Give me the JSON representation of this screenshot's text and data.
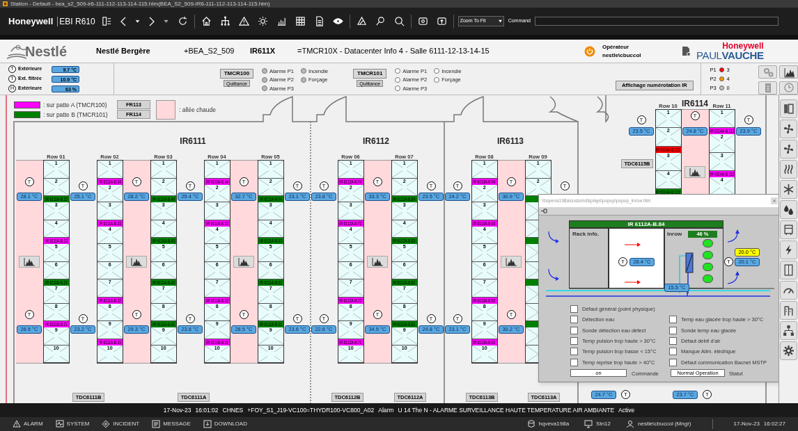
{
  "window": {
    "title": "Station - Default - bea_s2_509-ir6-111-112-113-114-115.htm(BEA_S2_509-IR6-111-112-113-114-115.htm)"
  },
  "toolbar": {
    "brand": "Honeywell",
    "product": "EBI R610",
    "zoom": "Zoom To Fit",
    "command_label": "Command"
  },
  "header": {
    "logo": "Nestlé",
    "site": "Nestlé Bergère",
    "location": "+BEA_S2_509",
    "unit": "IR611X",
    "description": "=TMCR10X - Datacenter Info 4 - Salle 6111-12-13-14-15",
    "operator_label": "Opérateur",
    "operator": "nestle\\cbuccol",
    "brand": "Honeywell",
    "brand_sub": "PAUL**VAUCHE**"
  },
  "outdoor": [
    {
      "sensor": "T",
      "label": "Extérieure",
      "value": "9.7 °C"
    },
    {
      "sensor": "T",
      "label": "Ext. filtrée",
      "value": "10.9 °C"
    },
    {
      "sensor": "H",
      "label": "Extérieure",
      "value": "63 %"
    }
  ],
  "controllers": [
    {
      "name": "TMCR100",
      "ack": "Quittance",
      "greyed": true,
      "alarms": [
        "Alarme P1",
        "Alarme P2",
        "Alarme P3"
      ],
      "others": [
        "Incendie",
        "Forçage"
      ]
    },
    {
      "name": "TMCR101",
      "ack": "Quittance",
      "greyed": false,
      "alarms": [
        "Alarme P1",
        "Alarme P2",
        "Alarme P3"
      ],
      "others": [
        "Incendie",
        "Forçage"
      ]
    }
  ],
  "numbering_button": "Affichage numérotation IR",
  "priorities": [
    {
      "label": "P1",
      "color": "#ff0000",
      "count": "3"
    },
    {
      "label": "P2",
      "color": "#ff9900",
      "count": "4"
    },
    {
      "label": "P3",
      "color": "#c0c0c0",
      "count": "0"
    }
  ],
  "legend": [
    {
      "color": "#ff00ff",
      "text": ": sur patte A (TMCR100)",
      "button": "FR113"
    },
    {
      "color": "#008000",
      "text": ": sur patte B (TMCR101)",
      "button": "FR114"
    }
  ],
  "hot_legend": ": allée chaude",
  "rooms": [
    {
      "title": "IR6111",
      "buttons": [
        "TDC6111B",
        "TDC6111A"
      ],
      "columns": [
        {
          "kind": "hot",
          "chart": true,
          "temps": [
            {
              "sensor": "T",
              "value": "28.1 °C"
            },
            {
              "sensor": "T",
              "value": "26.5 °C"
            }
          ]
        },
        {
          "kind": "rack",
          "label": "Row 01",
          "items": [
            {
              "kind": "slot",
              "label": "1"
            },
            {
              "kind": "slot",
              "label": "2"
            },
            {
              "kind": "tag",
              "text": "IR 6111A-B.22",
              "color": "#008000"
            },
            {
              "kind": "slot",
              "label": "3"
            },
            {
              "kind": "slot",
              "label": "4"
            },
            {
              "kind": "tag",
              "text": "IR 6111A-B.12",
              "color": "#ff00ff"
            },
            {
              "kind": "slot",
              "label": "5"
            },
            {
              "kind": "slot",
              "label": "6"
            },
            {
              "kind": "tag",
              "text": "IR 6111A-B.21",
              "color": "#008000"
            },
            {
              "kind": "slot",
              "label": "7"
            },
            {
              "kind": "slot",
              "label": "8"
            },
            {
              "kind": "tag",
              "text": "IR 6111A-B.11",
              "color": "#ff00ff"
            },
            {
              "kind": "slot",
              "label": "9"
            },
            {
              "kind": "slot",
              "label": "10"
            }
          ]
        },
        {
          "kind": "cold",
          "temps": [
            {
              "sensor": "T",
              "value": "25.1 °C"
            },
            {
              "sensor": "T",
              "value": "23.2 °C"
            }
          ]
        },
        {
          "kind": "rack",
          "label": "Row 02",
          "items": [
            {
              "kind": "slot",
              "label": "1"
            },
            {
              "kind": "tag",
              "text": "IR 6111A-B.34",
              "color": "#ff00ff"
            },
            {
              "kind": "slot",
              "label": "2"
            },
            {
              "kind": "slot",
              "label": "3"
            },
            {
              "kind": "tag",
              "text": "IR 6111A-B.33",
              "color": "#ff00ff"
            },
            {
              "kind": "slot",
              "label": "4"
            },
            {
              "kind": "slot",
              "label": "5"
            },
            {
              "kind": "slot",
              "label": "6"
            },
            {
              "kind": "slot",
              "label": "7"
            },
            {
              "kind": "tag",
              "text": "IR 6111A-B.32",
              "color": "#ff00ff"
            },
            {
              "kind": "slot",
              "label": "8"
            },
            {
              "kind": "slot",
              "label": "9"
            },
            {
              "kind": "tag",
              "text": "IR 6111A-B.31",
              "color": "#ff00ff"
            },
            {
              "kind": "slot",
              "label": "10"
            }
          ]
        },
        {
          "kind": "hot",
          "chart": true,
          "temps": [
            {
              "sensor": "T",
              "value": "28.2 °C"
            },
            {
              "sensor": "T",
              "value": "29.3 °C"
            }
          ]
        },
        {
          "kind": "rack",
          "label": "Row 03",
          "items": [
            {
              "kind": "slot",
              "label": "1"
            },
            {
              "kind": "slot",
              "label": "2"
            },
            {
              "kind": "tag",
              "text": "IR 6111A-B.44",
              "color": "#008000"
            },
            {
              "kind": "slot",
              "label": "3"
            },
            {
              "kind": "slot",
              "label": "4"
            },
            {
              "kind": "tag",
              "text": "IR 6111A-B.43",
              "color": "#008000"
            },
            {
              "kind": "slot",
              "label": "5"
            },
            {
              "kind": "slot",
              "label": "6"
            },
            {
              "kind": "tag",
              "text": "IR 6111A-B.42",
              "color": "#008000"
            },
            {
              "kind": "slot",
              "label": "7"
            },
            {
              "kind": "slot",
              "label": "8"
            },
            {
              "kind": "tag",
              "text": "IR 6111A-B.41",
              "color": "#008000"
            },
            {
              "kind": "slot",
              "label": "9"
            },
            {
              "kind": "slot",
              "label": "10"
            }
          ]
        },
        {
          "kind": "cold",
          "temps": [
            {
              "sensor": "T",
              "value": "25.4 °C"
            },
            {
              "sensor": "T",
              "value": "23.8 °C"
            }
          ]
        },
        {
          "kind": "rack",
          "label": "Row 04",
          "items": [
            {
              "kind": "slot",
              "label": "1"
            },
            {
              "kind": "tag",
              "text": "IR 6111A-B.34",
              "color": "#ff00ff"
            },
            {
              "kind": "slot",
              "label": "2"
            },
            {
              "kind": "slot",
              "label": "3"
            },
            {
              "kind": "tag",
              "text": "IR 6111A-B.33",
              "color": "#ff00ff"
            },
            {
              "kind": "slot",
              "label": "4"
            },
            {
              "kind": "slot",
              "label": "5"
            },
            {
              "kind": "slot",
              "label": "6"
            },
            {
              "kind": "slot",
              "label": "7"
            },
            {
              "kind": "tag",
              "text": "IR 6111A-B.32",
              "color": "#ff00ff"
            },
            {
              "kind": "slot",
              "label": "8"
            },
            {
              "kind": "slot",
              "label": "9"
            },
            {
              "kind": "tag",
              "text": "IR 6111A-B.31",
              "color": "#ff00ff"
            },
            {
              "kind": "slot",
              "label": "10"
            }
          ]
        },
        {
          "kind": "hot",
          "chart": true,
          "temps": [
            {
              "sensor": "T",
              "value": "32.7 °C"
            },
            {
              "sensor": "T",
              "value": "28.5 °C"
            }
          ]
        },
        {
          "kind": "rack",
          "label": "Row 05",
          "items": [
            {
              "kind": "slot",
              "label": "1"
            },
            {
              "kind": "slot",
              "label": "2"
            },
            {
              "kind": "tag",
              "text": "IR 6111A-B.04",
              "color": "#008000"
            },
            {
              "kind": "slot",
              "label": "3"
            },
            {
              "kind": "slot",
              "label": "4"
            },
            {
              "kind": "tag",
              "text": "IR 6111A-B.03",
              "color": "#008000"
            },
            {
              "kind": "slot",
              "label": "5"
            },
            {
              "kind": "slot",
              "label": "6"
            },
            {
              "kind": "tag",
              "text": "IR 6111A-B.02",
              "color": "#008000"
            },
            {
              "kind": "slot",
              "label": "7"
            },
            {
              "kind": "slot",
              "label": "8"
            },
            {
              "kind": "tag",
              "text": "IR 6111A-B.01",
              "color": "#008000"
            },
            {
              "kind": "slot",
              "label": "9"
            },
            {
              "kind": "slot",
              "label": "10"
            }
          ]
        },
        {
          "kind": "cold",
          "temps": [
            {
              "sensor": "T",
              "value": "23.1 °C"
            },
            {
              "sensor": "T",
              "value": "23.6 °C"
            }
          ]
        }
      ]
    },
    {
      "title": "IR6112",
      "buttons": [
        "TDC6112B",
        "TDC6112A"
      ],
      "columns": [
        {
          "kind": "cold",
          "temps": [
            {
              "sensor": "T",
              "value": "23.8 °C"
            },
            {
              "sensor": "T",
              "value": "22.6 °C"
            }
          ]
        },
        {
          "kind": "rack",
          "label": "Row 06",
          "items": [
            {
              "kind": "slot",
              "label": "1"
            },
            {
              "kind": "tag",
              "text": "IR 6112A-B.74",
              "color": "#ff00ff"
            },
            {
              "kind": "slot",
              "label": "2"
            },
            {
              "kind": "slot",
              "label": "3"
            },
            {
              "kind": "tag",
              "text": "IR 6112A-B.73",
              "color": "#ff00ff"
            },
            {
              "kind": "slot",
              "label": "4"
            },
            {
              "kind": "slot",
              "label": "5"
            },
            {
              "kind": "slot",
              "label": "6"
            },
            {
              "kind": "slot",
              "label": "7"
            },
            {
              "kind": "tag",
              "text": "IR 6112A-B.72",
              "color": "#ff00ff"
            },
            {
              "kind": "slot",
              "label": "8"
            },
            {
              "kind": "slot",
              "label": "9"
            },
            {
              "kind": "tag",
              "text": "IR 6112A-B.71",
              "color": "#ff00ff"
            },
            {
              "kind": "slot",
              "label": "10"
            }
          ]
        },
        {
          "kind": "hot",
          "chart": true,
          "temps": [
            {
              "sensor": "T",
              "value": "33.3 °C"
            },
            {
              "sensor": "T",
              "value": "34.5 °C"
            }
          ]
        },
        {
          "kind": "rack",
          "label": "Row 07",
          "items": [
            {
              "kind": "slot",
              "label": "1"
            },
            {
              "kind": "slot",
              "label": "2"
            },
            {
              "kind": "tag",
              "text": "IR 6112A-B.84",
              "color": "#008000"
            },
            {
              "kind": "slot",
              "label": "3"
            },
            {
              "kind": "slot",
              "label": "4"
            },
            {
              "kind": "tag",
              "text": "IR 6112A-B.83",
              "color": "#008000"
            },
            {
              "kind": "slot",
              "label": "5"
            },
            {
              "kind": "slot",
              "label": "6"
            },
            {
              "kind": "tag",
              "text": "IR 6112A-B.82",
              "color": "#008000"
            },
            {
              "kind": "slot",
              "label": "7"
            },
            {
              "kind": "slot",
              "label": "8"
            },
            {
              "kind": "tag",
              "text": "IR 6112A-B.81",
              "color": "#008000"
            },
            {
              "kind": "slot",
              "label": "9"
            },
            {
              "kind": "slot",
              "label": "10"
            }
          ]
        },
        {
          "kind": "cold",
          "temps": [
            {
              "sensor": "T",
              "value": "23.5 °C"
            },
            {
              "sensor": "T",
              "value": "24.8 °C"
            }
          ]
        }
      ]
    },
    {
      "title": "IR6113",
      "buttons": [
        "TDC6113B",
        "TDC6113A"
      ],
      "columns": [
        {
          "kind": "cold",
          "temps": [
            {
              "sensor": "T",
              "value": "24.2 °C"
            },
            {
              "sensor": "T",
              "value": "23.1 °C"
            }
          ]
        },
        {
          "kind": "rack",
          "label": "Row 08",
          "items": [
            {
              "kind": "slot",
              "label": "1"
            },
            {
              "kind": "tag",
              "text": "IR 6113A-B.94",
              "color": "#ff00ff"
            },
            {
              "kind": "slot",
              "label": "2"
            },
            {
              "kind": "slot",
              "label": "3"
            },
            {
              "kind": "tag",
              "text": "IR 6113A-B.93",
              "color": "#ff00ff"
            },
            {
              "kind": "slot",
              "label": "4"
            },
            {
              "kind": "slot",
              "label": "5"
            },
            {
              "kind": "slot",
              "label": "6"
            },
            {
              "kind": "slot",
              "label": "7"
            },
            {
              "kind": "tag",
              "text": "IR 6113A-B.92",
              "color": "#ff00ff"
            },
            {
              "kind": "slot",
              "label": "8"
            },
            {
              "kind": "slot",
              "label": "9"
            },
            {
              "kind": "tag",
              "text": "IR 6113A-B.91",
              "color": "#ff00ff"
            },
            {
              "kind": "slot",
              "label": "10"
            }
          ]
        },
        {
          "kind": "hot",
          "chart": true,
          "temps": [
            {
              "sensor": "T",
              "value": "30.9 °C"
            },
            {
              "sensor": "T",
              "value": "30.2 °C"
            }
          ]
        },
        {
          "kind": "rack",
          "label": "Row 09",
          "items": [
            {
              "kind": "slot",
              "label": "1"
            },
            {
              "kind": "slot",
              "label": "2"
            },
            {
              "kind": "tag",
              "color": "#008000"
            },
            {
              "kind": "slot"
            },
            {
              "kind": "slot"
            },
            {
              "kind": "tag",
              "color": "#008000"
            },
            {
              "kind": "slot"
            },
            {
              "kind": "slot"
            },
            {
              "kind": "tag",
              "color": "#008000"
            },
            {
              "kind": "slot"
            },
            {
              "kind": "slot"
            },
            {
              "kind": "tag",
              "color": "#008000"
            },
            {
              "kind": "slot"
            },
            {
              "kind": "slot"
            }
          ]
        },
        {
          "kind": "cold",
          "temps": [
            {
              "sensor": "T"
            }
          ]
        }
      ]
    },
    {
      "title": "IR6114",
      "buttons": [
        "TDC6115B"
      ],
      "bottom_temps": [
        {
          "sensor": "T",
          "value": "24.7 °C"
        },
        {
          "sensor": "T",
          "value": "23.7 °C"
        }
      ],
      "columns": [
        {
          "kind": "cold",
          "temps": [
            {
              "sensor": "T",
              "value": "23.5 °C"
            }
          ]
        },
        {
          "kind": "rack",
          "label": "Row 10",
          "items": [
            {
              "kind": "slot",
              "label": "1"
            },
            {
              "kind": "slot",
              "label": "2"
            },
            {
              "kind": "tag",
              "text": "IR 6114A-B.123",
              "color": "#ff0000"
            },
            {
              "kind": "slot",
              "label": "3"
            },
            {
              "kind": "slot",
              "label": "4"
            },
            {
              "kind": "tag",
              "text": "IR 6114A-B.122",
              "color": "#008000"
            }
          ]
        },
        {
          "kind": "hot",
          "chart": true,
          "temps": [
            {
              "sensor": "T",
              "value": "24.8 °C"
            }
          ]
        },
        {
          "kind": "rack",
          "label": "Row 11",
          "items": [
            {
              "kind": "slot",
              "label": "1"
            },
            {
              "kind": "tag",
              "text": "IR 6114A-B.113",
              "color": "#ff00ff"
            },
            {
              "kind": "slot",
              "label": "2"
            },
            {
              "kind": "slot",
              "label": "3"
            },
            {
              "kind": "tag",
              "text": "IR 6114A-B.112",
              "color": "#ff00ff"
            },
            {
              "kind": "slot",
              "label": "4"
            }
          ]
        },
        {
          "kind": "cold",
          "temps": [
            {
              "sensor": "T",
              "value": "23.9 °C"
            }
          ]
        }
      ]
    }
  ],
  "popup": {
    "path": "\\\\hqveva198a\\customdisplays\\popup\\popup_inrow.htm",
    "unit": "IR 6112A-B.84",
    "rack_info": "Rack info.",
    "inrow_label": "Inrow",
    "inrow_level": "46 %",
    "rack_temp": {
      "sensor": "T",
      "value": "28.4 °C"
    },
    "setpoint": "20.0 °C",
    "supply_temp": {
      "sensor": "T",
      "value": "20.1 °C"
    },
    "water_temp": "15.5 °C",
    "fans": [
      {
        "on": true
      },
      {
        "on": true
      },
      {
        "on": true
      },
      {
        "on": true
      }
    ],
    "faults_left": [
      {
        "label": "Défaut général (point physique)",
        "checked": false
      },
      {
        "label": "Détection eau",
        "checked": false
      },
      {
        "label": "Sonde détection eau défect",
        "checked": false
      },
      {
        "label": "Temp pulsion trop haute > 30°C",
        "checked": false
      },
      {
        "label": "Temp pulsion trop basse < 15°C",
        "checked": false
      },
      {
        "label": "Temp reprise trop haute > 40°C",
        "checked": false
      }
    ],
    "faults_right": [
      {
        "label": "Temp eau glacée trop haute > 30°C",
        "checked": false
      },
      {
        "label": "Sonde temp eau glacée",
        "checked": false
      },
      {
        "label": "Défaut debit d'air",
        "checked": false
      },
      {
        "label": "Manque Alim. élédrique",
        "checked": false
      },
      {
        "label": "Défaut communication Bacnet MSTP",
        "checked": false
      }
    ],
    "command": {
      "value": "on",
      "label": "Commande"
    },
    "status": {
      "value": "Normal Operation",
      "label": "Statut"
    }
  },
  "status_line": [
    "17-Nov-23",
    "16:01:02",
    "CHNES",
    "+FOY_S1_J19-VC100=THYDR100-VC800_A02",
    "Alarm",
    "U 14 The N - ALARME SURVEILLANCE HAUTE TEMPERATURE AIR AMBIANTE",
    "Active"
  ],
  "bottom_bar": {
    "nav": [
      "ALARM",
      "SYSTEM",
      "INCIDENT",
      "MESSAGE",
      "DOWNLOAD"
    ],
    "server": "hqveva198a",
    "station": "Stn12",
    "user": "nestle\\cbuccol (Mngr)",
    "date": "17-Nov-23",
    "time": "16:02:27"
  }
}
